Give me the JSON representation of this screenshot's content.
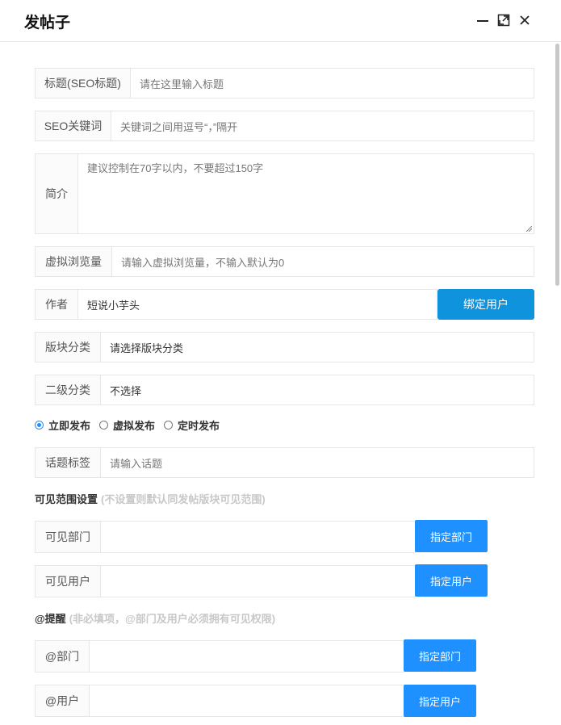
{
  "window": {
    "title": "发帖子",
    "icons": [
      "minimize-icon",
      "maximize-icon",
      "close-icon"
    ]
  },
  "form": {
    "title_label": "标题(SEO标题)",
    "title_placeholder": "请在这里输入标题",
    "keywords_label": "SEO关键词",
    "keywords_placeholder": "关键词之间用逗号“，”隔开",
    "summary_label": "简介",
    "summary_placeholder": "建议控制在70字以内，不要超过150字",
    "views_label": "虚拟浏览量",
    "views_placeholder": "请输入虚拟浏览量，不输入默认为0",
    "author_label": "作者",
    "author_value": "短说小芋头",
    "bind_user_label": "绑定用户",
    "section_label": "版块分类",
    "section_value": "请选择版块分类",
    "subcategory_label": "二级分类",
    "subcategory_value": "不选择",
    "publish_options": [
      {
        "label": "立即发布",
        "checked": true
      },
      {
        "label": "虚拟发布",
        "checked": false
      },
      {
        "label": "定时发布",
        "checked": false
      }
    ],
    "topic_label": "话题标签",
    "topic_placeholder": "请输入话题"
  },
  "visibility": {
    "heading": "可见范围设置",
    "hint": "(不设置则默认同发帖版块可见范围)",
    "dept_label": "可见部门",
    "dept_button": "指定部门",
    "user_label": "可见用户",
    "user_button": "指定用户"
  },
  "mention": {
    "heading": "@提醒",
    "hint": "(非必填项，@部门及用户必须拥有可见权限)",
    "dept_label": "@部门",
    "dept_button": "指定部门",
    "user_label": "@用户",
    "user_button": "指定用户"
  },
  "colors": {
    "accent": "#1e90ff",
    "bind_button": "#0f93dc",
    "border": "#e6e6e6",
    "hint": "#c8c8c8"
  }
}
